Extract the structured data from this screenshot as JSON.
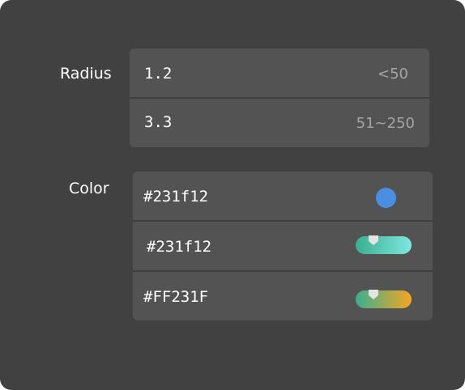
{
  "radius": {
    "label": "Radius",
    "rows": [
      {
        "value": "1.2",
        "hint": "<50"
      },
      {
        "value": "3.3",
        "hint": "51~250"
      }
    ]
  },
  "color": {
    "label": "Color",
    "rows": [
      {
        "value": "#231f12",
        "indicator": "color-dot",
        "swatch": "#4a8ee4"
      },
      {
        "value": "#231f12",
        "indicator": "gradient-slider",
        "gradient_from": "#3aaf8e",
        "gradient_to": "#7de8e0",
        "thumb_level": 0.2
      },
      {
        "value": "#FF231F",
        "indicator": "gradient-slider",
        "gradient_from": "#3aaf8e",
        "gradient_to": "#f5a623",
        "thumb_level": 0.2
      }
    ]
  }
}
